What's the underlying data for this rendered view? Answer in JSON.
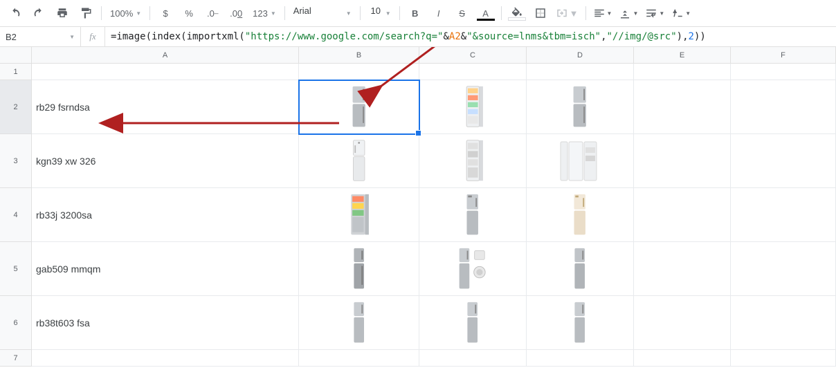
{
  "toolbar": {
    "zoom": "100%",
    "font": "Arial",
    "size": "10",
    "decimal_group": "123"
  },
  "namebox": "B2",
  "fx_label": "fx",
  "formula": {
    "p1": "=image(index(importxml(",
    "s1": "\"https://www.google.com/search?q=\"",
    "amp1": "&",
    "ref": "A2",
    "amp2": "&",
    "s2": "\"&source=lnms&tbm=isch\"",
    "comma1": ",",
    "s3": "\"//img/@src\"",
    "p2": "),",
    "num": "2",
    "p3": "))"
  },
  "cols": [
    "A",
    "B",
    "C",
    "D",
    "E",
    "F"
  ],
  "rows": [
    "1",
    "2",
    "3",
    "4",
    "5",
    "6",
    "7"
  ],
  "cells": {
    "A2": "rb29 fsrndsa",
    "A3": "kgn39 xw 326",
    "A4": "rb33j 3200sa",
    "A5": "gab509 mmqm",
    "A6": "rb38t603 fsa"
  }
}
